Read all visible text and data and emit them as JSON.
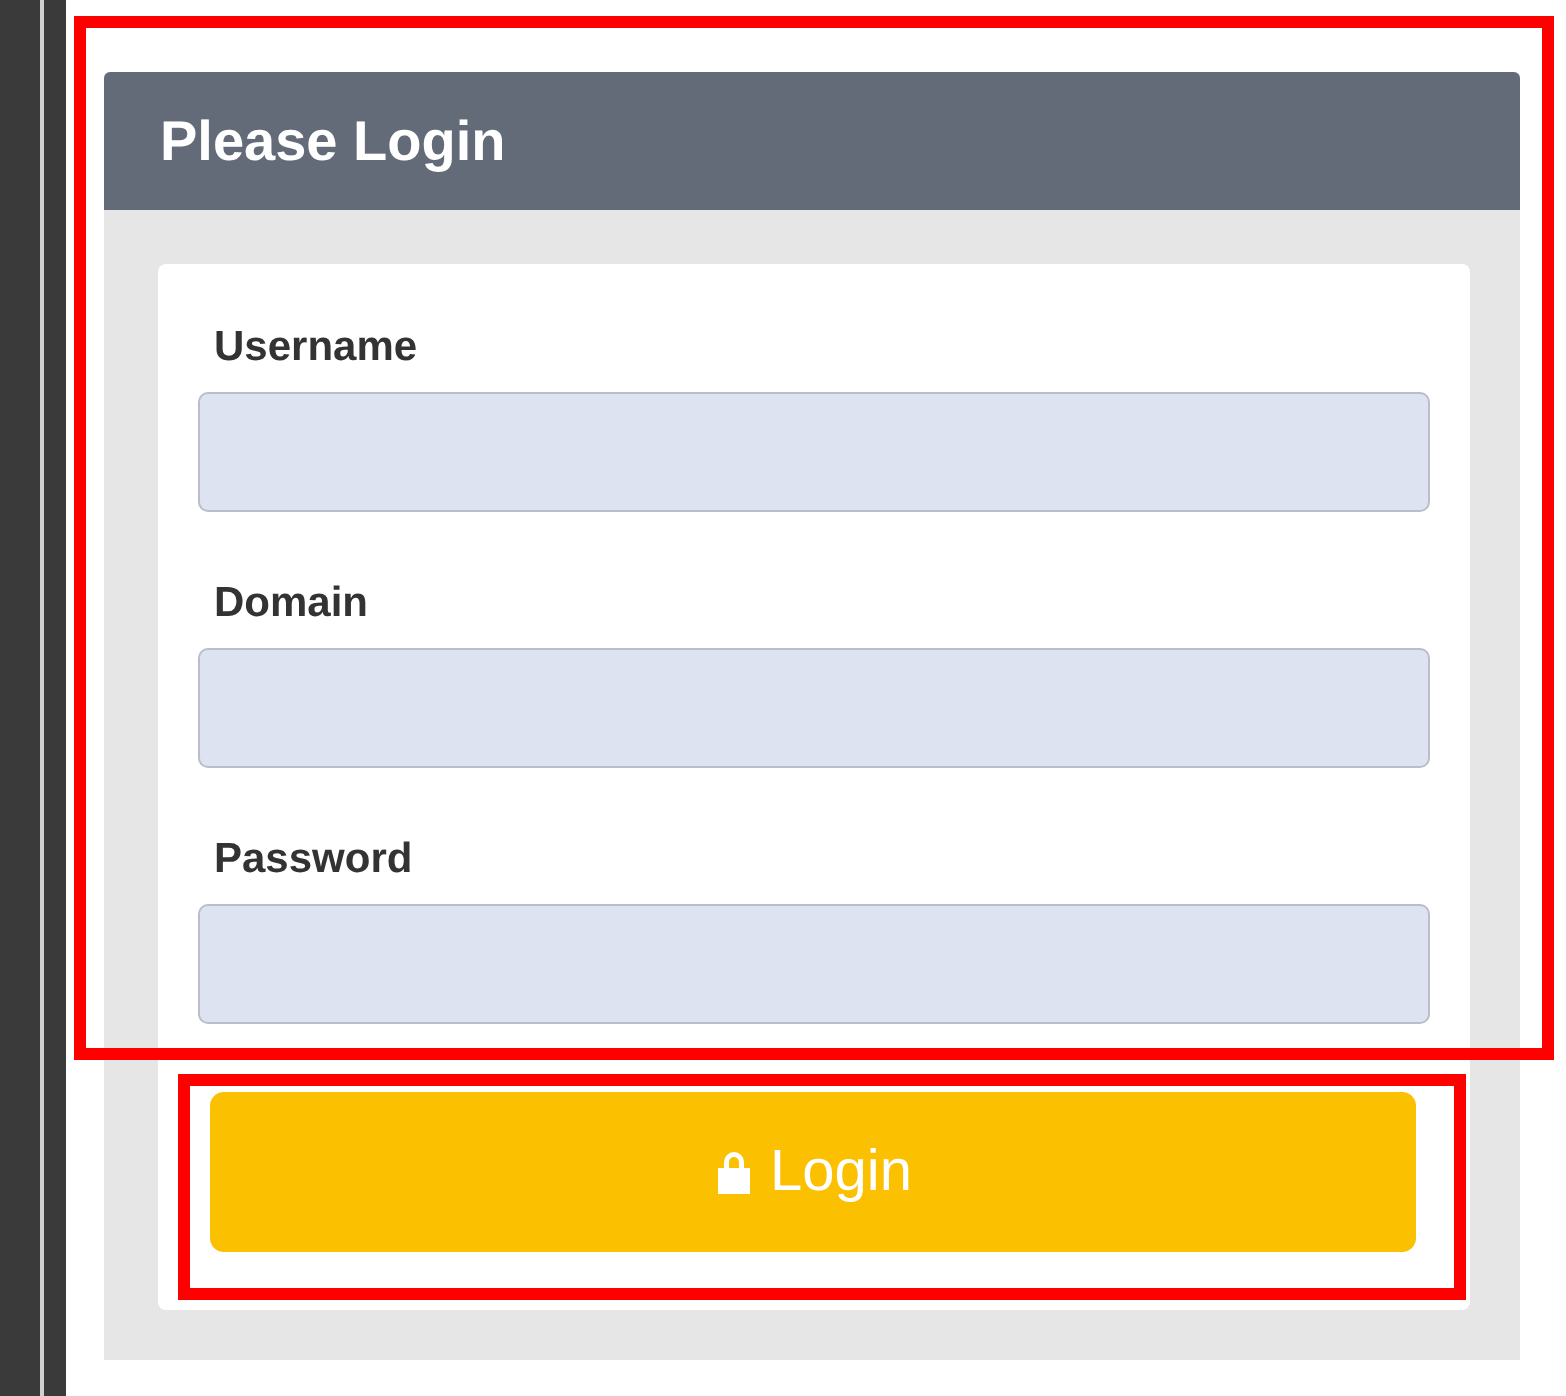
{
  "panel": {
    "title": "Please Login"
  },
  "fields": [
    {
      "label": "Username"
    },
    {
      "label": "Domain"
    },
    {
      "label": "Password"
    }
  ],
  "button": {
    "label": "Login"
  }
}
